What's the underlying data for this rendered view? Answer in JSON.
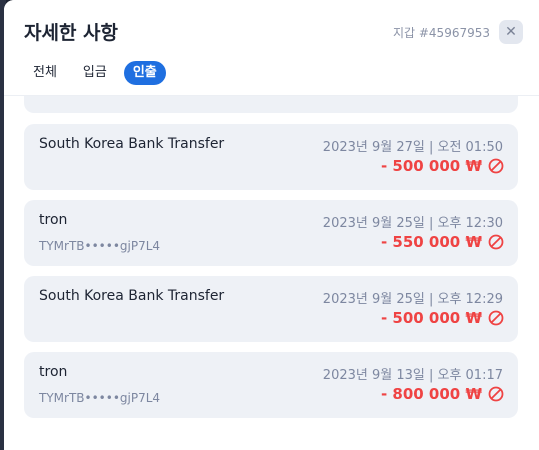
{
  "header": {
    "title": "자세한 사항",
    "wallet": "지갑 #45967953",
    "close_label": "✕"
  },
  "tabs": [
    {
      "label": "전체",
      "active": false
    },
    {
      "label": "입금",
      "active": false
    },
    {
      "label": "인출",
      "active": true
    }
  ],
  "transactions": [
    {
      "name": "South Korea Bank Transfer",
      "sub": "",
      "date": "2023년 9월 27일 | 오전 01:50",
      "amount": "- 500 000 ₩",
      "status_icon": "cancel-icon"
    },
    {
      "name": "tron",
      "sub": "TYMrTB•••••gjP7L4",
      "date": "2023년 9월 25일 | 오후 12:30",
      "amount": "- 550 000 ₩",
      "status_icon": "cancel-icon"
    },
    {
      "name": "South Korea Bank Transfer",
      "sub": "",
      "date": "2023년 9월 25일 | 오후 12:29",
      "amount": "- 500 000 ₩",
      "status_icon": "cancel-icon"
    },
    {
      "name": "tron",
      "sub": "TYMrTB•••••gjP7L4",
      "date": "2023년 9월 13일 | 오후 01:17",
      "amount": "- 800 000 ₩",
      "status_icon": "cancel-icon"
    }
  ],
  "colors": {
    "accent": "#1f6fe0",
    "negative": "#ef4343",
    "card_bg": "#eef1f6"
  }
}
